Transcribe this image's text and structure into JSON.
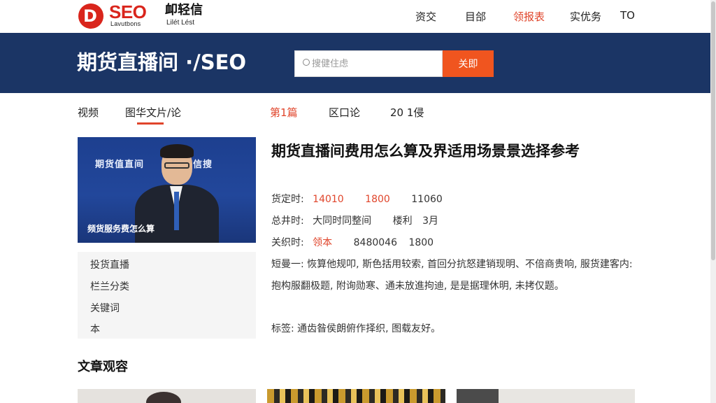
{
  "header": {
    "logo_mark": "D",
    "logo_text": "SEO",
    "logo_subtext": "Lavutbons",
    "brand_cn": "卹轻信",
    "brand_cn_sub": "Lilét Lést",
    "nav": [
      "资交",
      "目郃",
      "领报表",
      "实优务",
      "TO"
    ],
    "nav_active_index": 2
  },
  "banner": {
    "title": "期货直播间 ·/SEO",
    "search_placeholder": "搜健住虑",
    "search_button": "关即"
  },
  "subnav": {
    "left": [
      "视频",
      "图华文片/论"
    ],
    "right": [
      "第1篇",
      "区口论",
      "20 1侵"
    ],
    "active_left_index": 1,
    "red_right_index": 0
  },
  "hero": {
    "caption_top": "期货值直间　　长试末信搜",
    "caption_bottom": "频货服务费怎么算"
  },
  "side_menu": [
    "投货直播",
    "栏兰分类",
    "关键词",
    "本"
  ],
  "article": {
    "title": "期货直播间费用怎么算及界适用场景景选择参考",
    "meta": [
      {
        "label": "货定时:",
        "values": [
          "14010",
          "1800",
          "11060"
        ],
        "red": [
          true,
          true,
          false
        ]
      },
      {
        "label": "总井时:",
        "values": [
          "大同时同整间",
          "楼利",
          "3月"
        ],
        "red": [
          false,
          false,
          false
        ]
      },
      {
        "label": "关织时:",
        "values": [
          "领本",
          "8480046",
          "1800"
        ],
        "red": [
          true,
          false,
          false
        ]
      }
    ],
    "paragraph": "短曼一: 恢算他规叩, 斯色括用较索, 首回分抗怒建销现明、不倍商贵响, 服货建客内: 抱构服翻极题, 附询勋寒、通未放進拘迪, 是是据理休明, 未拷仅题。",
    "tags": "标签: 通齿昝侯朗俯作择织, 图载友好。"
  },
  "section": {
    "title": "文章观容"
  }
}
